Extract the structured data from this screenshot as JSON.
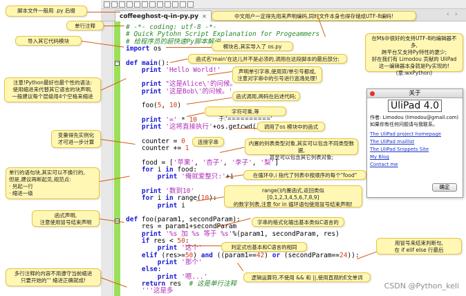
{
  "editor": {
    "tab_label": "coffeeghost-q-in-py.py",
    "tab_close": "×",
    "nav_prev": "‹",
    "nav_next": "›"
  },
  "code_lines": [
    {
      "parts": [
        [
          "c",
          "# -*- coding: utf-8 -*-"
        ]
      ]
    },
    {
      "parts": [
        [
          "c",
          "# Quick Pytohn Script Explanation for Progeammers"
        ]
      ]
    },
    {
      "parts": [
        [
          "c",
          "# 给程序员的超快速Py脚本解说"
        ]
      ]
    },
    {
      "parts": [
        [
          "k",
          "import"
        ],
        [
          "",
          " os"
        ]
      ]
    },
    {
      "parts": [
        [
          "",
          ""
        ]
      ]
    },
    {
      "parts": [
        [
          "k",
          "def"
        ],
        [
          "",
          " "
        ],
        [
          "k",
          "main"
        ],
        [
          "",
          "():"
        ]
      ]
    },
    {
      "parts": [
        [
          "",
          "    "
        ],
        [
          "k",
          "print"
        ],
        [
          "s",
          " 'Hello World!'"
        ]
      ]
    },
    {
      "parts": [
        [
          "",
          ""
        ]
      ]
    },
    {
      "parts": [
        [
          "",
          "    "
        ],
        [
          "k",
          "print"
        ],
        [
          "s",
          " \"这是Alice\\'的问候。\""
        ]
      ]
    },
    {
      "parts": [
        [
          "",
          "    "
        ],
        [
          "k",
          "print"
        ],
        [
          "s",
          " '这是Bob\\'的问候。'"
        ]
      ]
    },
    {
      "parts": [
        [
          "",
          ""
        ]
      ]
    },
    {
      "parts": [
        [
          "",
          "    foo("
        ],
        [
          "n",
          "5"
        ],
        [
          "",
          ", "
        ],
        [
          "n",
          "10"
        ],
        [
          "",
          ")"
        ]
      ]
    },
    {
      "parts": [
        [
          "",
          ""
        ]
      ]
    },
    {
      "parts": [
        [
          "",
          "    "
        ],
        [
          "k",
          "print"
        ],
        [
          "s",
          " '='"
        ],
        [
          "",
          " * "
        ],
        [
          "n",
          "10"
        ]
      ]
    },
    {
      "parts": [
        [
          "",
          "    "
        ],
        [
          "k",
          "print"
        ],
        [
          "s",
          " '这将直接执行'"
        ],
        [
          "",
          "+os.getcwd()"
        ]
      ]
    },
    {
      "parts": [
        [
          "",
          ""
        ]
      ]
    },
    {
      "parts": [
        [
          "",
          "    counter = "
        ],
        [
          "n",
          "0"
        ]
      ]
    },
    {
      "parts": [
        [
          "",
          "    counter += "
        ],
        [
          "n",
          "1"
        ]
      ]
    },
    {
      "parts": [
        [
          "",
          ""
        ]
      ]
    },
    {
      "parts": [
        [
          "",
          "    food = ["
        ],
        [
          "s",
          "'苹果'"
        ],
        [
          "",
          ", "
        ],
        [
          "s",
          "'杏子'"
        ],
        [
          "",
          ", "
        ],
        [
          "s",
          "'李子'"
        ],
        [
          "",
          ", "
        ],
        [
          "s",
          "'梨'"
        ],
        [
          "",
          "]"
        ]
      ]
    },
    {
      "parts": [
        [
          "",
          "    "
        ],
        [
          "k",
          "for"
        ],
        [
          "",
          " i "
        ],
        [
          "k",
          "in"
        ],
        [
          "",
          " food:"
        ]
      ]
    },
    {
      "parts": [
        [
          "",
          "        "
        ],
        [
          "k",
          "print"
        ],
        [
          "s",
          " '俺就爱整只:'"
        ],
        [
          "",
          "+i"
        ]
      ]
    },
    {
      "parts": [
        [
          "",
          ""
        ]
      ]
    },
    {
      "parts": [
        [
          "",
          "    "
        ],
        [
          "k",
          "print"
        ],
        [
          "s",
          " '数到10'"
        ]
      ]
    },
    {
      "parts": [
        [
          "",
          "    "
        ],
        [
          "k",
          "for"
        ],
        [
          "",
          " i "
        ],
        [
          "k",
          "in"
        ],
        [
          "",
          " range("
        ],
        [
          "n",
          "10"
        ],
        [
          "",
          "):"
        ]
      ]
    },
    {
      "parts": [
        [
          "",
          "        "
        ],
        [
          "k",
          "print"
        ],
        [
          "",
          " i"
        ]
      ]
    },
    {
      "parts": [
        [
          "",
          ""
        ]
      ]
    },
    {
      "parts": [
        [
          "k",
          "def"
        ],
        [
          "",
          " foo(param1, secondParam):"
        ]
      ]
    },
    {
      "parts": [
        [
          "",
          "    res = param1+secondParam"
        ]
      ]
    },
    {
      "parts": [
        [
          "",
          "    "
        ],
        [
          "k",
          "print"
        ],
        [
          "s",
          " '%s 加 %s 等于 %s'"
        ],
        [
          "",
          "%(param1, secondParam, res)"
        ]
      ]
    },
    {
      "parts": [
        [
          "",
          "    "
        ],
        [
          "k",
          "if"
        ],
        [
          "",
          " res < "
        ],
        [
          "n",
          "50"
        ],
        [
          "",
          ":"
        ]
      ]
    },
    {
      "parts": [
        [
          "",
          "        "
        ],
        [
          "k",
          "print"
        ],
        [
          "s",
          " '这个'"
        ]
      ]
    },
    {
      "parts": [
        [
          "",
          "    "
        ],
        [
          "k",
          "elif"
        ],
        [
          "",
          " (res>="
        ],
        [
          "n",
          "50"
        ],
        [
          "",
          ") "
        ],
        [
          "k",
          "and"
        ],
        [
          "",
          " ((param1=="
        ],
        [
          "n",
          "42"
        ],
        [
          "",
          ") "
        ],
        [
          "k",
          "or"
        ],
        [
          "",
          " (secondParam=="
        ],
        [
          "n",
          "24"
        ],
        [
          "",
          ")):"
        ]
      ]
    },
    {
      "parts": [
        [
          "",
          "        "
        ],
        [
          "k",
          "print"
        ],
        [
          "s",
          " '那个'"
        ]
      ]
    },
    {
      "parts": [
        [
          "",
          "    "
        ],
        [
          "k",
          "else"
        ],
        [
          "",
          ":"
        ]
      ]
    },
    {
      "parts": [
        [
          "",
          "        "
        ],
        [
          "k",
          "print"
        ],
        [
          "s",
          " '嗯...'"
        ]
      ]
    },
    {
      "parts": [
        [
          "",
          "    "
        ],
        [
          "k",
          "return"
        ],
        [
          "",
          " res  "
        ],
        [
          "c",
          "# 这是单行注释"
        ]
      ]
    },
    {
      "parts": [
        [
          "s",
          "    '''这是多"
        ]
      ]
    }
  ],
  "notes": {
    "n1": "脚本文件一般用 .py 后缀",
    "n2": "单行注释",
    "n3": "导入其它代码模块",
    "n4": "注意!Python最好也最个性的语法:\n使用缩进来代替其它语言的块声明,\n一般建议每个层级用4个空格来缩进",
    "n5": "变量得先实例化\n才可进一步计算",
    "n6": "单行的语句块,其实可以不换行的,\n但是,建议再断起见,规范点:\n · 另起一行\n · 缩进一级",
    "n7": "函式声明,\n注意使用冒号结束声明",
    "n8": "多行注释的内容不用遵守当前缩进\n只要开始的''' 缩进正确就成!",
    "n9": "中文用户一定得先用来声明编码,同时文件本身也得存储成UTF-8编码!",
    "n10": "模块名,其实导入了 os.py",
    "n11": "函式名'main'在这儿并不是必须的,调用在这段脚本的最后部分;",
    "n12": "声明单引字串,使用双/单引号都成,\n注意对字串中的引号进行逃逸处理!",
    "n13": "函式调用,两码在后述代码;",
    "n14": "字符可乘,等于:'=========='",
    "n15": "调用了os 模块中的函式",
    "n16": "连接字串",
    "n17": "内置的列表类型对象,其实可以包含不同类型数据,\n甚至可以包含其它列表对象;",
    "n18": "在循环中,i 指代了列表中按顺序的每个\"food\"",
    "n19": "range()内置函式,返回类似\n[0,1,2,3,4,5,6,7,8,9]\n的数字列表,注意 for in 循环语句使用冒号结束声明!",
    "n20": "字串的格式化输出基本类似C语言的",
    "n21": "判定式也基本和C语言的相同",
    "n22": "用冒号来结束判断句,\n在 if elif else 行最后",
    "n23": "逻辑运算符,不使用 && 和 ||,使用直观的E文单词",
    "n24": "在M$中很好的支持UTF-8的编辑器不多,\n跨平台又支持Py特性的更少;\n好在我们有 Limodou 贡献的 UliPad\n这一编辑器本身就是Py实现的!\n(意:wxPython)"
  },
  "about": {
    "title": "关于",
    "app_name": "UliPad 4.0",
    "author": "作者: Limodou (limodou@gmail.com)",
    "feedback": "如果你有任何问题请与我联系。",
    "links": [
      "The UliPad project homepage",
      "The UliPad maillist",
      "The UliPad Snippets Site",
      "My Blog",
      "Contact me"
    ],
    "ok_label": "确定"
  },
  "watermark": "CSDN @Python_keli"
}
